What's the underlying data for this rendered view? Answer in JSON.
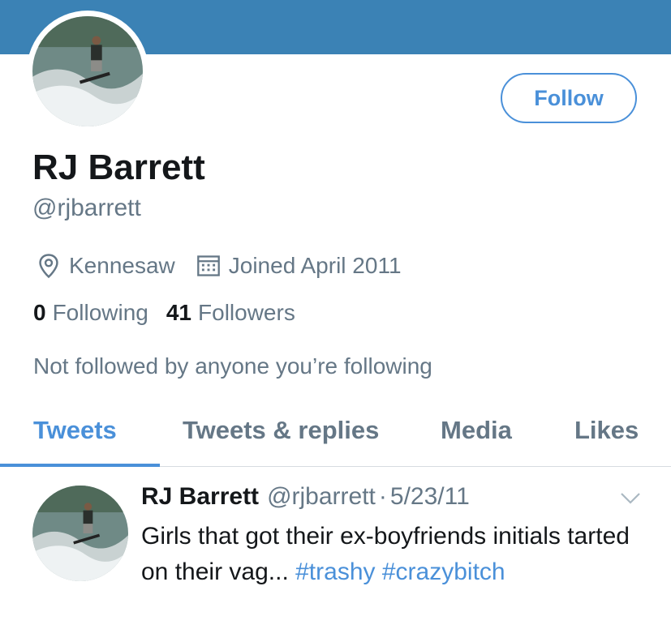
{
  "profile": {
    "name": "RJ Barrett",
    "handle": "@rjbarrett",
    "location": "Kennesaw",
    "joined": "Joined April 2011",
    "following_count": "0",
    "following_label": "Following",
    "followers_count": "41",
    "followers_label": "Followers",
    "not_followed_text": "Not followed by anyone you’re following"
  },
  "follow_button": {
    "label": "Follow"
  },
  "tabs": [
    {
      "label": "Tweets",
      "active": true
    },
    {
      "label": "Tweets & replies",
      "active": false
    },
    {
      "label": "Media",
      "active": false
    },
    {
      "label": "Likes",
      "active": false
    }
  ],
  "tweet": {
    "name": "RJ Barrett",
    "handle": "@rjbarrett",
    "separator": "·",
    "date": "5/23/11",
    "text": "Girls that got their ex-boyfriends initials tarted on their vag...",
    "hashtags": [
      "#trashy",
      "#crazybitch"
    ]
  },
  "icons": {
    "location": "location-pin-icon",
    "calendar": "calendar-icon",
    "caret": "chevron-down-icon"
  },
  "colors": {
    "banner": "#3b82b5",
    "accent": "#4a90d9",
    "secondary_text": "#657786",
    "primary_text": "#14171a"
  }
}
